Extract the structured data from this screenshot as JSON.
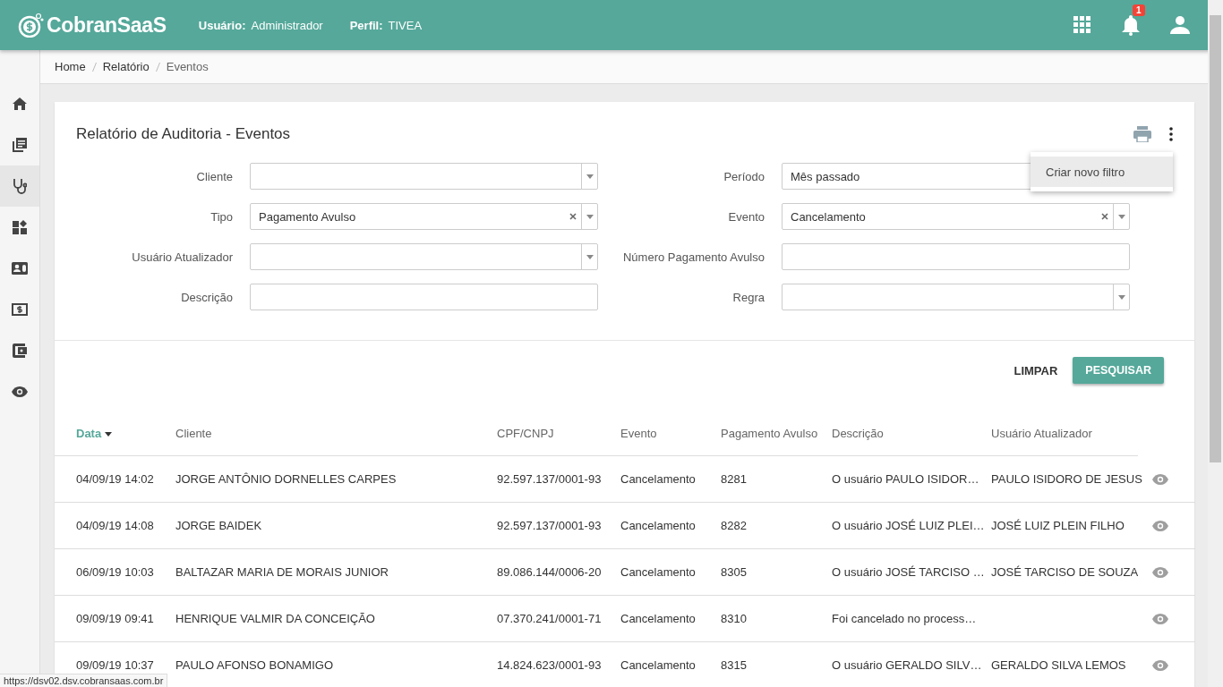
{
  "header": {
    "brand": "CobranSaaS",
    "user_label": "Usuário:",
    "user_value": "Administrador",
    "profile_label": "Perfil:",
    "profile_value": "TIVEA",
    "notification_count": "1"
  },
  "sidebar": {
    "items": [
      {
        "selected": false
      },
      {
        "selected": false
      },
      {
        "selected": true
      },
      {
        "selected": false
      },
      {
        "selected": false
      },
      {
        "selected": false
      },
      {
        "selected": false
      },
      {
        "selected": false
      }
    ]
  },
  "breadcrumb": [
    "Home",
    "Relatório",
    "Eventos"
  ],
  "report": {
    "title": "Relatório de Auditoria - Eventos",
    "menu": {
      "items": [
        {
          "label": "Criar novo filtro",
          "hovered": true
        }
      ]
    },
    "filters": [
      {
        "label": "Cliente",
        "kind": "select"
      },
      {
        "label": "Período",
        "kind": "select",
        "value": "Mês passado"
      },
      {
        "label": "Tipo",
        "kind": "select",
        "value": "Pagamento Avulso",
        "clearable": true
      },
      {
        "label": "Evento",
        "kind": "select",
        "value": "Cancelamento",
        "clearable": true
      },
      {
        "label": "Usuário Atualizador",
        "kind": "select"
      },
      {
        "label": "Número Pagamento Avulso",
        "kind": "text"
      },
      {
        "label": "Descrição",
        "kind": "text"
      },
      {
        "label": "Regra",
        "kind": "select"
      }
    ],
    "buttons": {
      "clear": "LIMPAR",
      "search": "PESQUISAR"
    },
    "table": {
      "columns": [
        {
          "label": "Data",
          "sorted": true
        },
        {
          "label": "Cliente",
          "sorted": false
        },
        {
          "label": "CPF/CNPJ",
          "sorted": false
        },
        {
          "label": "Evento",
          "sorted": false
        },
        {
          "label": "Pagamento Avulso",
          "sorted": false
        },
        {
          "label": "Descrição",
          "sorted": false
        },
        {
          "label": "Usuário Atualizador",
          "sorted": false
        }
      ],
      "rows": [
        [
          "04/09/19 14:02",
          "JORGE ANTÔNIO DORNELLES CARPES",
          "92.597.137/0001-93",
          "Cancelamento",
          "8281",
          "O usuário PAULO ISIDOR…",
          "PAULO ISIDORO DE JESUS"
        ],
        [
          "04/09/19 14:08",
          "JORGE BAIDEK",
          "92.597.137/0001-93",
          "Cancelamento",
          "8282",
          "O usuário JOSÉ LUIZ PLEI…",
          "JOSÉ LUIZ PLEIN FILHO"
        ],
        [
          "06/09/19 10:03",
          "BALTAZAR MARIA DE MORAIS JUNIOR",
          "89.086.144/0006-20",
          "Cancelamento",
          "8305",
          "O usuário JOSÉ TARCISO …",
          "JOSÉ TARCISO DE SOUZA"
        ],
        [
          "09/09/19 09:41",
          "HENRIQUE VALMIR DA CONCEIÇÃO",
          "07.370.241/0001-71",
          "Cancelamento",
          "8310",
          "Foi cancelado no process…",
          ""
        ],
        [
          "09/09/19 10:37",
          "PAULO AFONSO BONAMIGO",
          "14.824.623/0001-93",
          "Cancelamento",
          "8315",
          "O usuário GERALDO SILV…",
          "GERALDO SILVA LEMOS"
        ]
      ]
    }
  },
  "status_url": "https://dsv02.dsv.cobransaas.com.br"
}
